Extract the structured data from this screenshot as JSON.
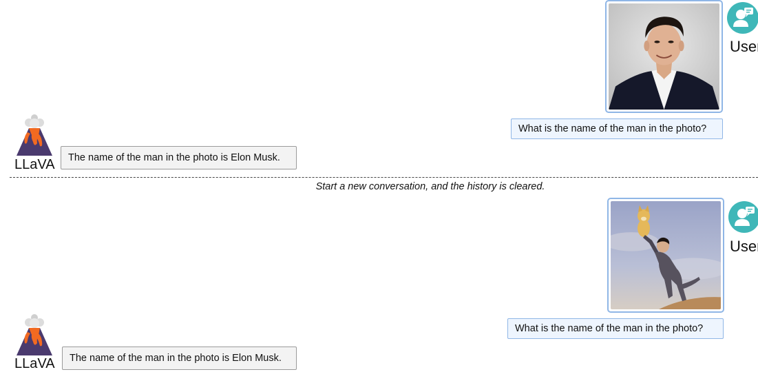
{
  "user_label": "User",
  "bot_label": "LLaVA",
  "divider_text": "Start a new conversation, and the history is cleared.",
  "conversations": [
    {
      "image_icon": "portrait-photo",
      "question": "What is the name of the man in the photo?",
      "answer": "The name of the man in the photo is Elon Musk."
    },
    {
      "image_icon": "meme-illustration",
      "question": "What is the name of the man in the photo?",
      "answer": "The name of the man in the photo is Elon Musk."
    }
  ],
  "icons": {
    "user": "user-chat-icon",
    "bot": "llava-volcano-logo"
  },
  "colors": {
    "user_avatar": "#3fb7b8",
    "user_bubble_bg": "#eef5fe",
    "user_bubble_border": "#8fb6e6",
    "bot_bubble_bg": "#f3f3f3",
    "bot_bubble_border": "#9a9a9a",
    "volcano_dark": "#4a3a6e",
    "lava": "#f26a21"
  }
}
